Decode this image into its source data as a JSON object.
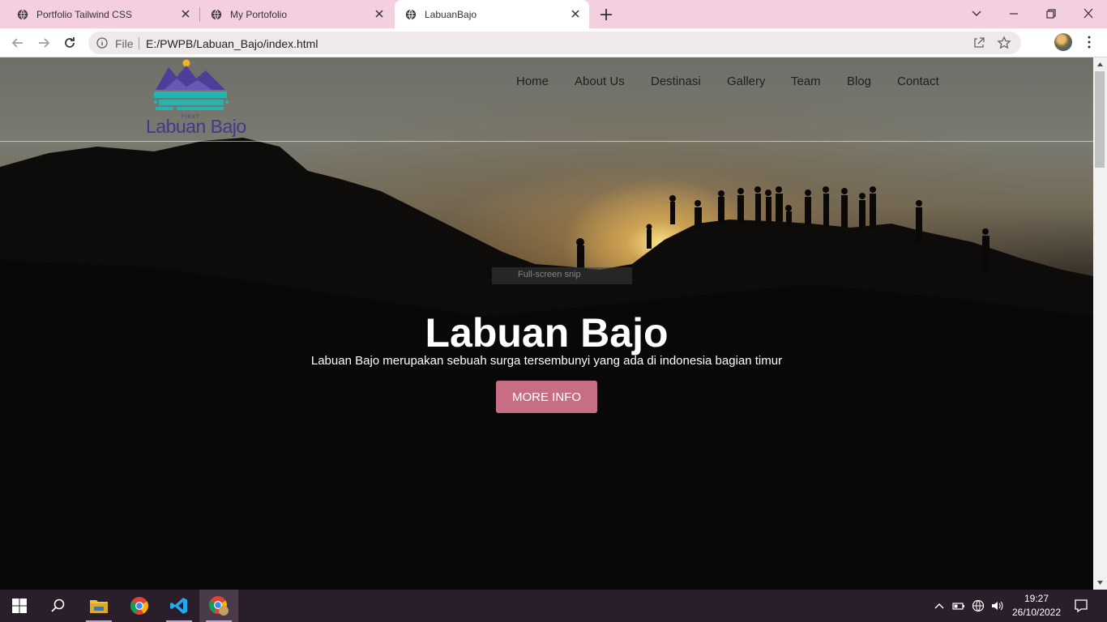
{
  "browser": {
    "tabs": [
      {
        "title": "Portfolio Tailwind CSS",
        "active": false
      },
      {
        "title": "My Portofolio",
        "active": false
      },
      {
        "title": "LabuanBajo",
        "active": true
      }
    ],
    "omnibox": {
      "scheme_label": "File",
      "url": "E:/PWPB/Labuan_Bajo/index.html"
    }
  },
  "page": {
    "logo": {
      "small_text": "FIRST",
      "name": "Labuan Bajo"
    },
    "nav": [
      "Home",
      "About Us",
      "Destinasi",
      "Gallery",
      "Team",
      "Blog",
      "Contact"
    ],
    "tooltip": "Full-screen snip",
    "hero": {
      "title": "Labuan Bajo",
      "subtitle": "Labuan Bajo merupakan sebuah surga tersembunyi yang ada di indonesia bagian timur",
      "button": "MORE INFO"
    },
    "colors": {
      "accent_button": "#c76e85",
      "logo_purple": "#4d3e9a",
      "logo_teal": "#1fb5b0",
      "tab_strip": "#f3cfe0"
    }
  },
  "taskbar": {
    "apps": [
      "start-icon",
      "search-icon",
      "file-explorer-icon",
      "chrome-icon",
      "vscode-icon",
      "chrome-profile-icon"
    ],
    "clock": {
      "time": "19:27",
      "date": "26/10/2022"
    }
  }
}
